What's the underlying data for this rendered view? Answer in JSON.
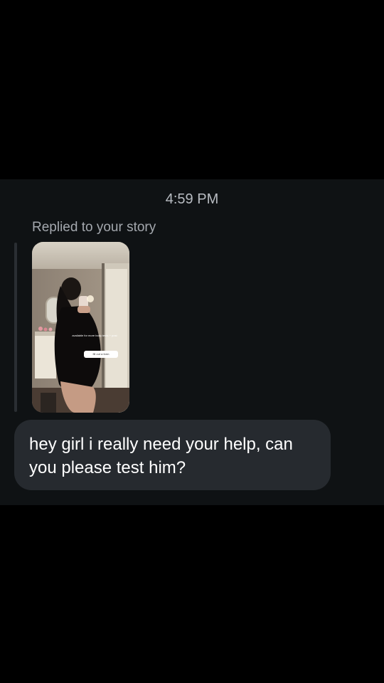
{
  "chat": {
    "timestamp": "4:59 PM",
    "reply_context": "Replied to your story",
    "story": {
      "caption_text": "available for more body tests + post",
      "sticker_text": "fill out a form"
    },
    "message": {
      "text": "hey girl i really need your help, can you please test him?"
    }
  },
  "colors": {
    "background": "#000000",
    "chat_panel": "#0f1214",
    "bubble": "#262a2f",
    "message_text": "#ffffff",
    "meta_text": "#b8bcc2"
  }
}
